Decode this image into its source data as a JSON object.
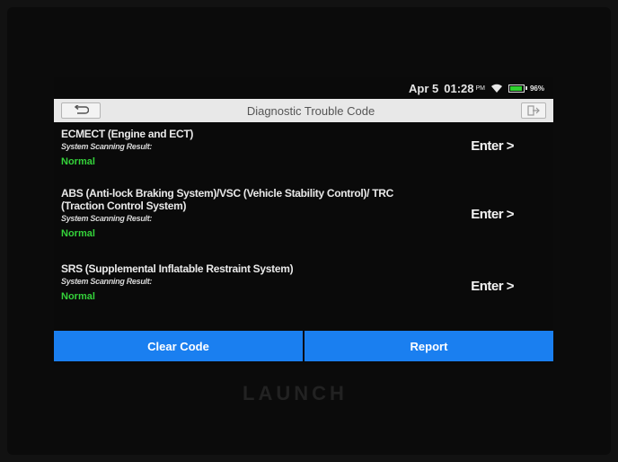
{
  "status_bar": {
    "date": "Apr 5",
    "time": "01:28",
    "ampm": "PM",
    "battery": "96%",
    "battery_level": 0.96,
    "wifi_icon": "wifi-icon",
    "colors": {
      "battery_fill": "#2fd12f"
    }
  },
  "header": {
    "title": "Diagnostic Trouble Code",
    "back_icon": "back-arrow-icon",
    "exit_icon": "exit-icon"
  },
  "systems": [
    {
      "name": "ECMECT (Engine and ECT)",
      "result_label": "System Scanning Result:",
      "status": "Normal",
      "enter_label": "Enter >"
    },
    {
      "name": "ABS (Anti-lock Braking System)/VSC (Vehicle Stability Control)/ TRC (Traction Control System)",
      "result_label": "System Scanning Result:",
      "status": "Normal",
      "enter_label": "Enter >"
    },
    {
      "name": "SRS (Supplemental Inflatable Restraint System)",
      "result_label": "System Scanning Result:",
      "status": "Normal",
      "enter_label": "Enter >"
    }
  ],
  "actions": {
    "clear_code": "Clear Code",
    "report": "Report"
  },
  "device": {
    "brand": "LAUNCH"
  },
  "colors": {
    "accent": "#1a7ff0",
    "status_normal": "#34d23a",
    "title_bar": "#e8e8e8"
  }
}
